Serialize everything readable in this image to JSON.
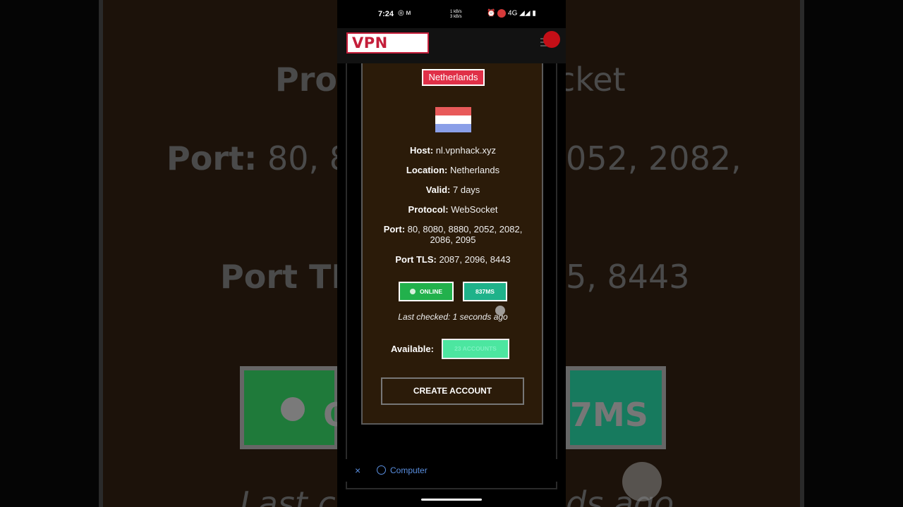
{
  "status_bar": {
    "time": "7:24",
    "speed_up": "1 kB/s",
    "speed_down": "3 kB/s",
    "network": "4G"
  },
  "app": {
    "logo": "VPN"
  },
  "server": {
    "country": "Netherlands",
    "host_label": "Host:",
    "host": "nl.vpnhack.xyz",
    "location_label": "Location:",
    "location": "Netherlands",
    "valid_label": "Valid:",
    "valid": "7 days",
    "protocol_label": "Protocol:",
    "protocol": "WebSocket",
    "port_label": "Port:",
    "port": "80, 8080, 8880, 2052, 2082, 2086, 2095",
    "port_tls_label": "Port TLS:",
    "port_tls": "2087, 2096, 8443",
    "status": "ONLINE",
    "ping": "837MS",
    "last_checked": "Last checked: 1 seconds ago",
    "available_label": "Available:",
    "available": "23 ACCOUNTS",
    "create_button": "CREATE ACCOUNT"
  },
  "browser_bar": {
    "close_icon": "×",
    "label": "Computer"
  },
  "background": {
    "line1_bold": "Prot",
    "line1_tail": "cket",
    "line2_bold": "Port:",
    "line2_a": " 80, 8",
    "line2_b": "052, 2082,",
    "line3_bold": "Port TL",
    "line3_b": "5, 8443",
    "pill_left": "O",
    "pill_right": "7MS",
    "bottom_a": "Last ch",
    "bottom_b": "ds ago"
  },
  "colors": {
    "accent": "#c41e3a",
    "online": "#22b14c",
    "ping": "#1fb28a",
    "available": "#4ce6a0",
    "card_bg": "#2b1b09"
  }
}
